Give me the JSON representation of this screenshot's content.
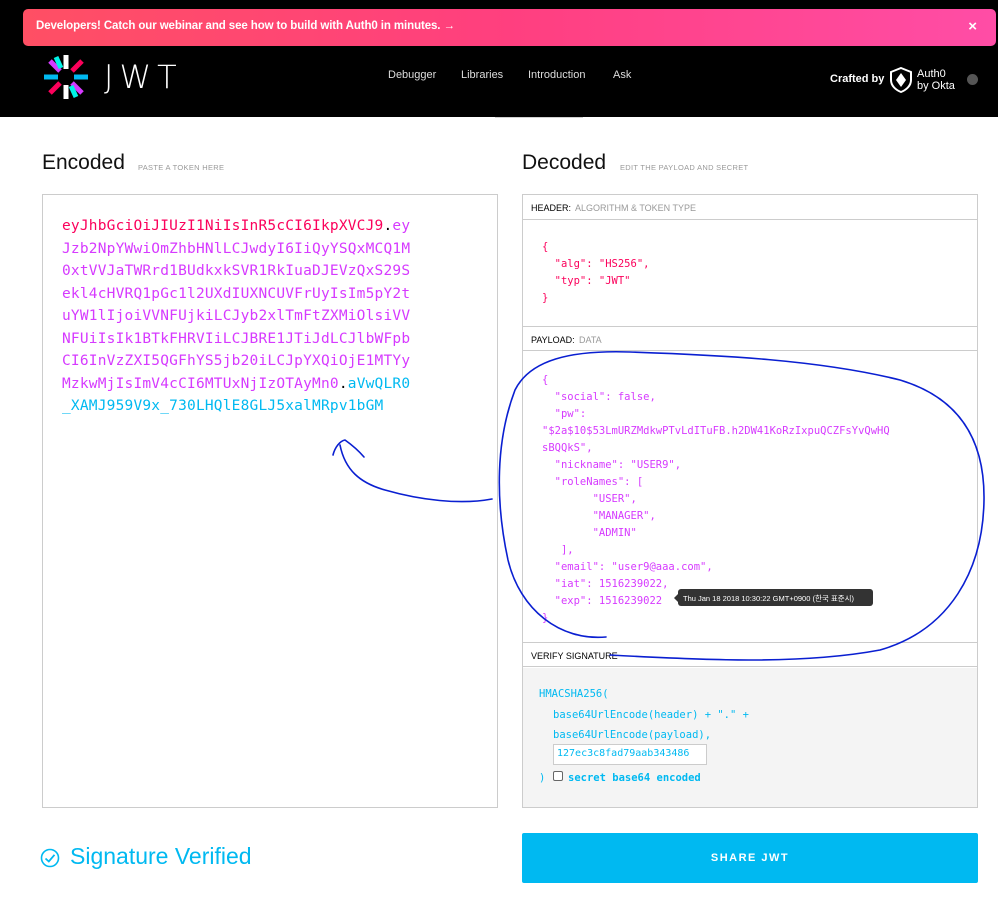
{
  "banner": {
    "text": "Developers! Catch our webinar and see how to build with Auth0 in minutes.",
    "arrow": "→",
    "close": "×"
  },
  "brand": {
    "wordmark": "JWT"
  },
  "nav": {
    "items": [
      "Debugger",
      "Libraries",
      "Introduction",
      "Ask"
    ]
  },
  "crafted": {
    "label": "Crafted by",
    "line1": "Auth0",
    "line2": "by Okta"
  },
  "encoded": {
    "title": "Encoded",
    "subtitle": "PASTE A TOKEN HERE",
    "lines": [
      {
        "h": "eyJhbGciOiJIUzI1NiIsInR5cCI6IkpXVCJ9",
        "d": ".",
        "p": "ey"
      },
      {
        "p": "Jzb2NpYWwiOmZhbHNlLCJwdyI6IiQyYSQxMCQ1M"
      },
      {
        "p": "0xtVVJaTWRrd1BUdkxkSVR1RkIuaDJEVzQxS29S"
      },
      {
        "p": "ekl4cHVRQ1pGc1l2UXdIUXNCUVFrUyIsIm5pY2t"
      },
      {
        "p": "uYW1lIjoiVVNFUjkiLCJyb2xlTmFtZXMiOlsiVV"
      },
      {
        "p": "NFUiIsIk1BTkFHRVIiLCJBRE1JTiJdLCJlbWFpb"
      },
      {
        "p": "CI6InVzZXI5QGFhYS5jb20iLCJpYXQiOjE1MTYy"
      },
      {
        "p": "MzkwMjIsImV4cCI6MTUxNjIzOTAyMn0",
        "d": ".",
        "s": "aVwQLR0"
      },
      {
        "s": "_XAMJ959V9x_730LHQlE8GLJ5xalMRpv1bGM"
      }
    ]
  },
  "decoded": {
    "title": "Decoded",
    "subtitle": "EDIT THE PAYLOAD AND SECRET",
    "header_label": "HEADER:",
    "header_sub": "ALGORITHM & TOKEN TYPE",
    "header_json": "{\n  \"alg\": \"HS256\",\n  \"typ\": \"JWT\"\n}",
    "payload_label": "PAYLOAD:",
    "payload_sub": "DATA",
    "payload_json": "{\n  \"social\": false,\n  \"pw\":\n\"$2a$10$53LmURZMdkwPTvLdITuFB.h2DW41KoRzIxpuQCZFsYvQwHQ\nsBQQkS\",\n  \"nickname\": \"USER9\",\n  \"roleNames\": [\n        \"USER\",\n        \"MANAGER\",\n        \"ADMIN\"\n   ],\n  \"email\": \"user9@aaa.com\",\n  \"iat\": 1516239022,\n  \"exp\": 1516239022\n}",
    "tooltip": "Thu Jan 18 2018 10:30:22 GMT+0900 (한국 표준시)",
    "verify_label": "VERIFY SIGNATURE",
    "verify": {
      "l1": "HMACSHA256(",
      "l2": "base64UrlEncode(header) + \".\" +",
      "l3": "base64UrlEncode(payload),",
      "secret": "127ec3c8fad79aab343486",
      "l5a": ")",
      "l5b": "secret base64 encoded"
    }
  },
  "status": {
    "verified": "Signature Verified"
  },
  "share": {
    "label": "SHARE JWT"
  },
  "colors": {
    "header": "#fb015b",
    "payload": "#d63aff",
    "signature": "#00b9f1"
  }
}
